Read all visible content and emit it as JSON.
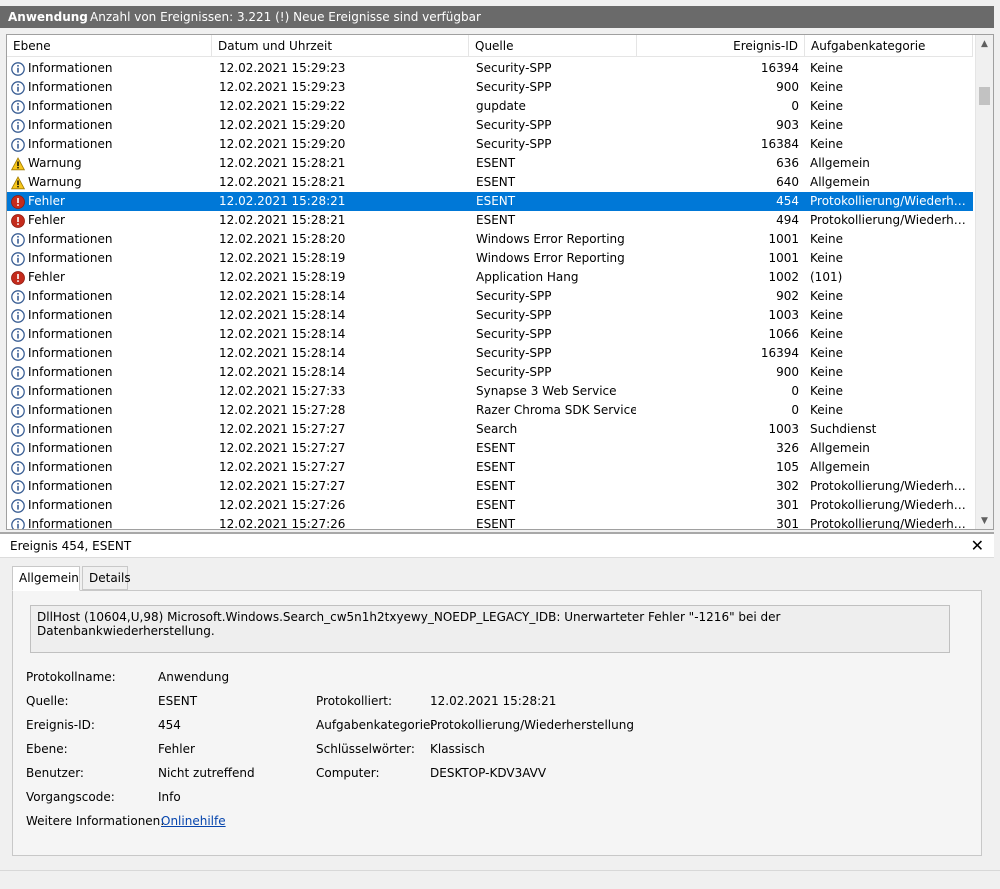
{
  "header": {
    "title": "Anwendung",
    "subtitle": "Anzahl von Ereignissen: 3.221 (!) Neue Ereignisse sind verfügbar"
  },
  "columns": {
    "level": "Ebene",
    "date": "Datum und Uhrzeit",
    "source": "Quelle",
    "id": "Ereignis-ID",
    "category": "Aufgabenkategorie"
  },
  "events": [
    {
      "level": "Informationen",
      "icon": "info-icon",
      "date": "12.02.2021 15:29:23",
      "source": "Security-SPP",
      "id": "16394",
      "category": "Keine"
    },
    {
      "level": "Informationen",
      "icon": "info-icon",
      "date": "12.02.2021 15:29:23",
      "source": "Security-SPP",
      "id": "900",
      "category": "Keine"
    },
    {
      "level": "Informationen",
      "icon": "info-icon",
      "date": "12.02.2021 15:29:22",
      "source": "gupdate",
      "id": "0",
      "category": "Keine"
    },
    {
      "level": "Informationen",
      "icon": "info-icon",
      "date": "12.02.2021 15:29:20",
      "source": "Security-SPP",
      "id": "903",
      "category": "Keine"
    },
    {
      "level": "Informationen",
      "icon": "info-icon",
      "date": "12.02.2021 15:29:20",
      "source": "Security-SPP",
      "id": "16384",
      "category": "Keine"
    },
    {
      "level": "Warnung",
      "icon": "warning-icon",
      "date": "12.02.2021 15:28:21",
      "source": "ESENT",
      "id": "636",
      "category": "Allgemein"
    },
    {
      "level": "Warnung",
      "icon": "warning-icon",
      "date": "12.02.2021 15:28:21",
      "source": "ESENT",
      "id": "640",
      "category": "Allgemein"
    },
    {
      "level": "Fehler",
      "icon": "error-icon",
      "date": "12.02.2021 15:28:21",
      "source": "ESENT",
      "id": "454",
      "category": "Protokollierung/Wiederhers...",
      "selected": true
    },
    {
      "level": "Fehler",
      "icon": "error-icon",
      "date": "12.02.2021 15:28:21",
      "source": "ESENT",
      "id": "494",
      "category": "Protokollierung/Wiederhers..."
    },
    {
      "level": "Informationen",
      "icon": "info-icon",
      "date": "12.02.2021 15:28:20",
      "source": "Windows Error Reporting",
      "id": "1001",
      "category": "Keine"
    },
    {
      "level": "Informationen",
      "icon": "info-icon",
      "date": "12.02.2021 15:28:19",
      "source": "Windows Error Reporting",
      "id": "1001",
      "category": "Keine"
    },
    {
      "level": "Fehler",
      "icon": "error-icon",
      "date": "12.02.2021 15:28:19",
      "source": "Application Hang",
      "id": "1002",
      "category": "(101)"
    },
    {
      "level": "Informationen",
      "icon": "info-icon",
      "date": "12.02.2021 15:28:14",
      "source": "Security-SPP",
      "id": "902",
      "category": "Keine"
    },
    {
      "level": "Informationen",
      "icon": "info-icon",
      "date": "12.02.2021 15:28:14",
      "source": "Security-SPP",
      "id": "1003",
      "category": "Keine"
    },
    {
      "level": "Informationen",
      "icon": "info-icon",
      "date": "12.02.2021 15:28:14",
      "source": "Security-SPP",
      "id": "1066",
      "category": "Keine"
    },
    {
      "level": "Informationen",
      "icon": "info-icon",
      "date": "12.02.2021 15:28:14",
      "source": "Security-SPP",
      "id": "16394",
      "category": "Keine"
    },
    {
      "level": "Informationen",
      "icon": "info-icon",
      "date": "12.02.2021 15:28:14",
      "source": "Security-SPP",
      "id": "900",
      "category": "Keine"
    },
    {
      "level": "Informationen",
      "icon": "info-icon",
      "date": "12.02.2021 15:27:33",
      "source": "Synapse 3 Web Service",
      "id": "0",
      "category": "Keine"
    },
    {
      "level": "Informationen",
      "icon": "info-icon",
      "date": "12.02.2021 15:27:28",
      "source": "Razer Chroma SDK Service",
      "id": "0",
      "category": "Keine"
    },
    {
      "level": "Informationen",
      "icon": "info-icon",
      "date": "12.02.2021 15:27:27",
      "source": "Search",
      "id": "1003",
      "category": "Suchdienst"
    },
    {
      "level": "Informationen",
      "icon": "info-icon",
      "date": "12.02.2021 15:27:27",
      "source": "ESENT",
      "id": "326",
      "category": "Allgemein"
    },
    {
      "level": "Informationen",
      "icon": "info-icon",
      "date": "12.02.2021 15:27:27",
      "source": "ESENT",
      "id": "105",
      "category": "Allgemein"
    },
    {
      "level": "Informationen",
      "icon": "info-icon",
      "date": "12.02.2021 15:27:27",
      "source": "ESENT",
      "id": "302",
      "category": "Protokollierung/Wiederhers..."
    },
    {
      "level": "Informationen",
      "icon": "info-icon",
      "date": "12.02.2021 15:27:26",
      "source": "ESENT",
      "id": "301",
      "category": "Protokollierung/Wiederhers..."
    },
    {
      "level": "Informationen",
      "icon": "info-icon",
      "date": "12.02.2021 15:27:26",
      "source": "ESENT",
      "id": "301",
      "category": "Protokollierung/Wiederhers..."
    }
  ],
  "detail": {
    "title": "Ereignis 454, ESENT",
    "tab_general": "Allgemein",
    "tab_details": "Details",
    "message": "DllHost (10604,U,98) Microsoft.Windows.Search_cw5n1h2txyewy_NOEDP_LEGACY_IDB: Unerwarteter Fehler \"-1216\" bei der Datenbankwiederherstellung.",
    "fields": {
      "log_name_label": "Protokollname:",
      "log_name": "Anwendung",
      "source_label": "Quelle:",
      "source": "ESENT",
      "logged_label": "Protokolliert:",
      "logged": "12.02.2021 15:28:21",
      "event_id_label": "Ereignis-ID:",
      "event_id": "454",
      "task_category_label": "Aufgabenkategorie:",
      "task_category": "Protokollierung/Wiederherstellung",
      "level_label": "Ebene:",
      "level": "Fehler",
      "keywords_label": "Schlüsselwörter:",
      "keywords": "Klassisch",
      "user_label": "Benutzer:",
      "user": "Nicht zutreffend",
      "computer_label": "Computer:",
      "computer": "DESKTOP-KDV3AVV",
      "opcode_label": "Vorgangscode:",
      "opcode": "Info",
      "more_info_label": "Weitere Informationen:",
      "more_info_link": "Onlinehilfe"
    }
  },
  "colors": {
    "selection": "#0078d7",
    "title_bar": "#6a6a6a",
    "link": "#0645ad"
  }
}
